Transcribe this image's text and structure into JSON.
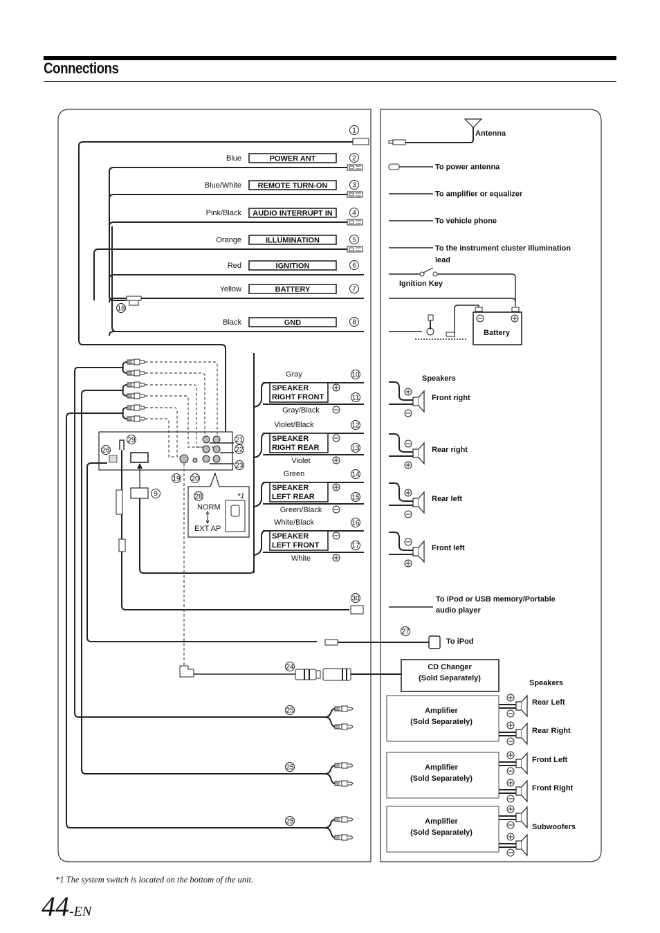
{
  "page": {
    "title": "Connections",
    "footnote_mark": "*1",
    "footnote": "The system switch is located on the bottom of the unit.",
    "page_number": "44",
    "page_suffix": "-EN"
  },
  "head_unit_leads": [
    {
      "num": "1",
      "color": "",
      "label": ""
    },
    {
      "num": "2",
      "color": "Blue",
      "label": "POWER ANT"
    },
    {
      "num": "3",
      "color": "Blue/White",
      "label": "REMOTE TURN-ON"
    },
    {
      "num": "4",
      "color": "Pink/Black",
      "label": "AUDIO INTERRUPT IN"
    },
    {
      "num": "5",
      "color": "Orange",
      "label": "ILLUMINATION"
    },
    {
      "num": "6",
      "color": "Red",
      "label": "IGNITION"
    },
    {
      "num": "7",
      "color": "Yellow",
      "label": "BATTERY"
    },
    {
      "num": "8",
      "color": "Black",
      "label": "GND"
    }
  ],
  "fuse_num": "18",
  "speaker_leads": [
    {
      "box_line1": "SPEAKER",
      "box_line2": "RIGHT FRONT",
      "top_color": "Gray",
      "top_num": "10",
      "top_sign": "+",
      "bottom_color": "Gray/Black",
      "bottom_num": "11",
      "bottom_sign": "−"
    },
    {
      "box_line1": "SPEAKER",
      "box_line2": "RIGHT REAR",
      "top_color": "Violet/Black",
      "top_num": "12",
      "top_sign": "−",
      "bottom_color": "Violet",
      "bottom_num": "13",
      "bottom_sign": "+"
    },
    {
      "box_line1": "SPEAKER",
      "box_line2": "LEFT REAR",
      "top_color": "Green",
      "top_num": "14",
      "top_sign": "+",
      "bottom_color": "Green/Black",
      "bottom_num": "15",
      "bottom_sign": "−"
    },
    {
      "box_line1": "SPEAKER",
      "box_line2": "LEFT FRONT",
      "top_color": "White/Black",
      "top_num": "16",
      "top_sign": "−",
      "bottom_color": "White",
      "bottom_num": "17",
      "bottom_sign": "+"
    }
  ],
  "unit_rear": {
    "nums": {
      "n9": "9",
      "n19": "19",
      "n20": "20",
      "n21": "21",
      "n22": "22",
      "n23": "23",
      "n26": "26",
      "n29": "29",
      "n28": "28"
    },
    "switch_top": "NORM",
    "switch_bottom": "EXT AP",
    "switch_note": "*1"
  },
  "other_leads": {
    "n30": "30",
    "n27": "27",
    "n24": "24",
    "n25": "25"
  },
  "right_panel": {
    "antenna": "Antenna",
    "power_antenna": "To power antenna",
    "amp_eq": "To amplifier or equalizer",
    "vehicle_phone": "To vehicle phone",
    "illumination_line1": "To the instrument cluster illumination",
    "illumination_line2": "lead",
    "ignition_key": "Ignition Key",
    "battery": "Battery",
    "speakers_title": "Speakers",
    "speakers": [
      {
        "label": "Front right",
        "top_sign": "+",
        "bottom_sign": "−"
      },
      {
        "label": "Rear right",
        "top_sign": "−",
        "bottom_sign": "+"
      },
      {
        "label": "Rear left",
        "top_sign": "+",
        "bottom_sign": "−"
      },
      {
        "label": "Front left",
        "top_sign": "−",
        "bottom_sign": "+"
      }
    ],
    "ipod_usb_line1": "To iPod or USB memory/Portable",
    "ipod_usb_line2": "audio player",
    "to_ipod": "To iPod",
    "cd_changer_line1": "CD Changer",
    "cd_changer_line2": "(Sold Separately)",
    "amp_speakers_title": "Speakers",
    "amplifiers": [
      {
        "line1": "Amplifier",
        "line2": "(Sold Separately)",
        "speakers": [
          "Rear Left",
          "Rear Right"
        ]
      },
      {
        "line1": "Amplifier",
        "line2": "(Sold Separately)",
        "speakers": [
          "Front Left",
          "Front Right"
        ]
      },
      {
        "line1": "Amplifier",
        "line2": "(Sold Separately)",
        "speakers": [
          "Subwoofers"
        ]
      }
    ]
  }
}
